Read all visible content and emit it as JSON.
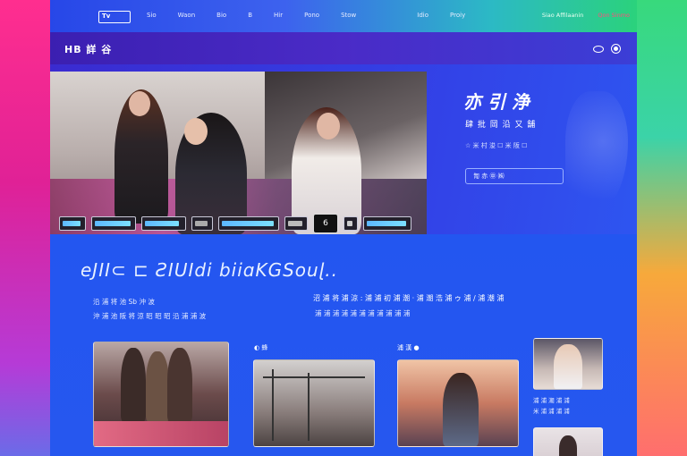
{
  "topnav": {
    "logo_text": "Tv",
    "links": [
      "Sio",
      "Waon",
      "Bio",
      "B",
      "Hir",
      "Pono",
      "Stow",
      "Idio",
      "Proiy"
    ],
    "right": [
      "Siao Affilaanin",
      "Qon Sinmo"
    ]
  },
  "subbar": {
    "brand": "HB 詳 谷"
  },
  "hero": {
    "title": "亦 引 浄",
    "subtitle": "肆 批 岡   沿 又 舗",
    "meta": "☆ 米 村 浚 ☐ 米 阪 ☐",
    "button": "㔨 赤 ㊥ ㈱"
  },
  "main": {
    "headline": "eJII⊂ ⊏ ƧIUIdi biiɑKGSouɭ..",
    "line_l1": "沿 浦 将 池     Sb 沖 波",
    "line_l2": "沖 浦 池 阪 将 涼 昭 昭 昭 沿 浦 浦 波",
    "line_r1": "沼 浦 将 浦 涼 : 浦 浦 初 浦 潮 · 浦 潮 浩 浦 ゥ 浦 ∕ 浦 潮 浦",
    "line_r2": "浦 浦 浦 浦 浦 浦 浦 浦     浦 浦 浦",
    "card_mid_label": "◐ 蜂",
    "card_right_label": "浦 漢 ●",
    "side_text1": "浦 浦 潮 浦 浦",
    "side_text2": "米 浦 浦 浦 浦"
  },
  "controls": {
    "play": "6"
  }
}
